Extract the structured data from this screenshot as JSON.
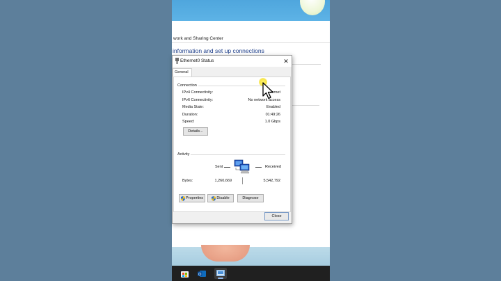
{
  "background_window": {
    "breadcrumb": "work and Sharing Center",
    "heading": "information and set up connections"
  },
  "dialog": {
    "title": "Ethernet0 Status",
    "tab": "General",
    "connection": {
      "group_label": "Connection",
      "rows": [
        {
          "label": "IPv4 Connectivity:",
          "value": "Internet"
        },
        {
          "label": "IPv6 Connectivity:",
          "value": "No network access"
        },
        {
          "label": "Media State:",
          "value": "Enabled"
        },
        {
          "label": "Duration:",
          "value": "01:49:26"
        },
        {
          "label": "Speed:",
          "value": "1.0 Gbps"
        }
      ],
      "details_button": "Details..."
    },
    "activity": {
      "group_label": "Activity",
      "sent_label": "Sent",
      "received_label": "Received",
      "bytes_label": "Bytes:",
      "bytes_sent": "1,260,669",
      "bytes_received": "5,542,792"
    },
    "buttons": {
      "properties": "Properties",
      "disable": "Disable",
      "diagnose": "Diagnose",
      "close": "Close"
    }
  },
  "taskbar": {
    "icons": [
      "microsoft-store-icon",
      "outlook-icon",
      "network-status-icon"
    ]
  },
  "colors": {
    "accent_heading": "#1e3f8a",
    "cursor_highlight": "#f7e54a",
    "outer_background": "#5d7f9b"
  }
}
